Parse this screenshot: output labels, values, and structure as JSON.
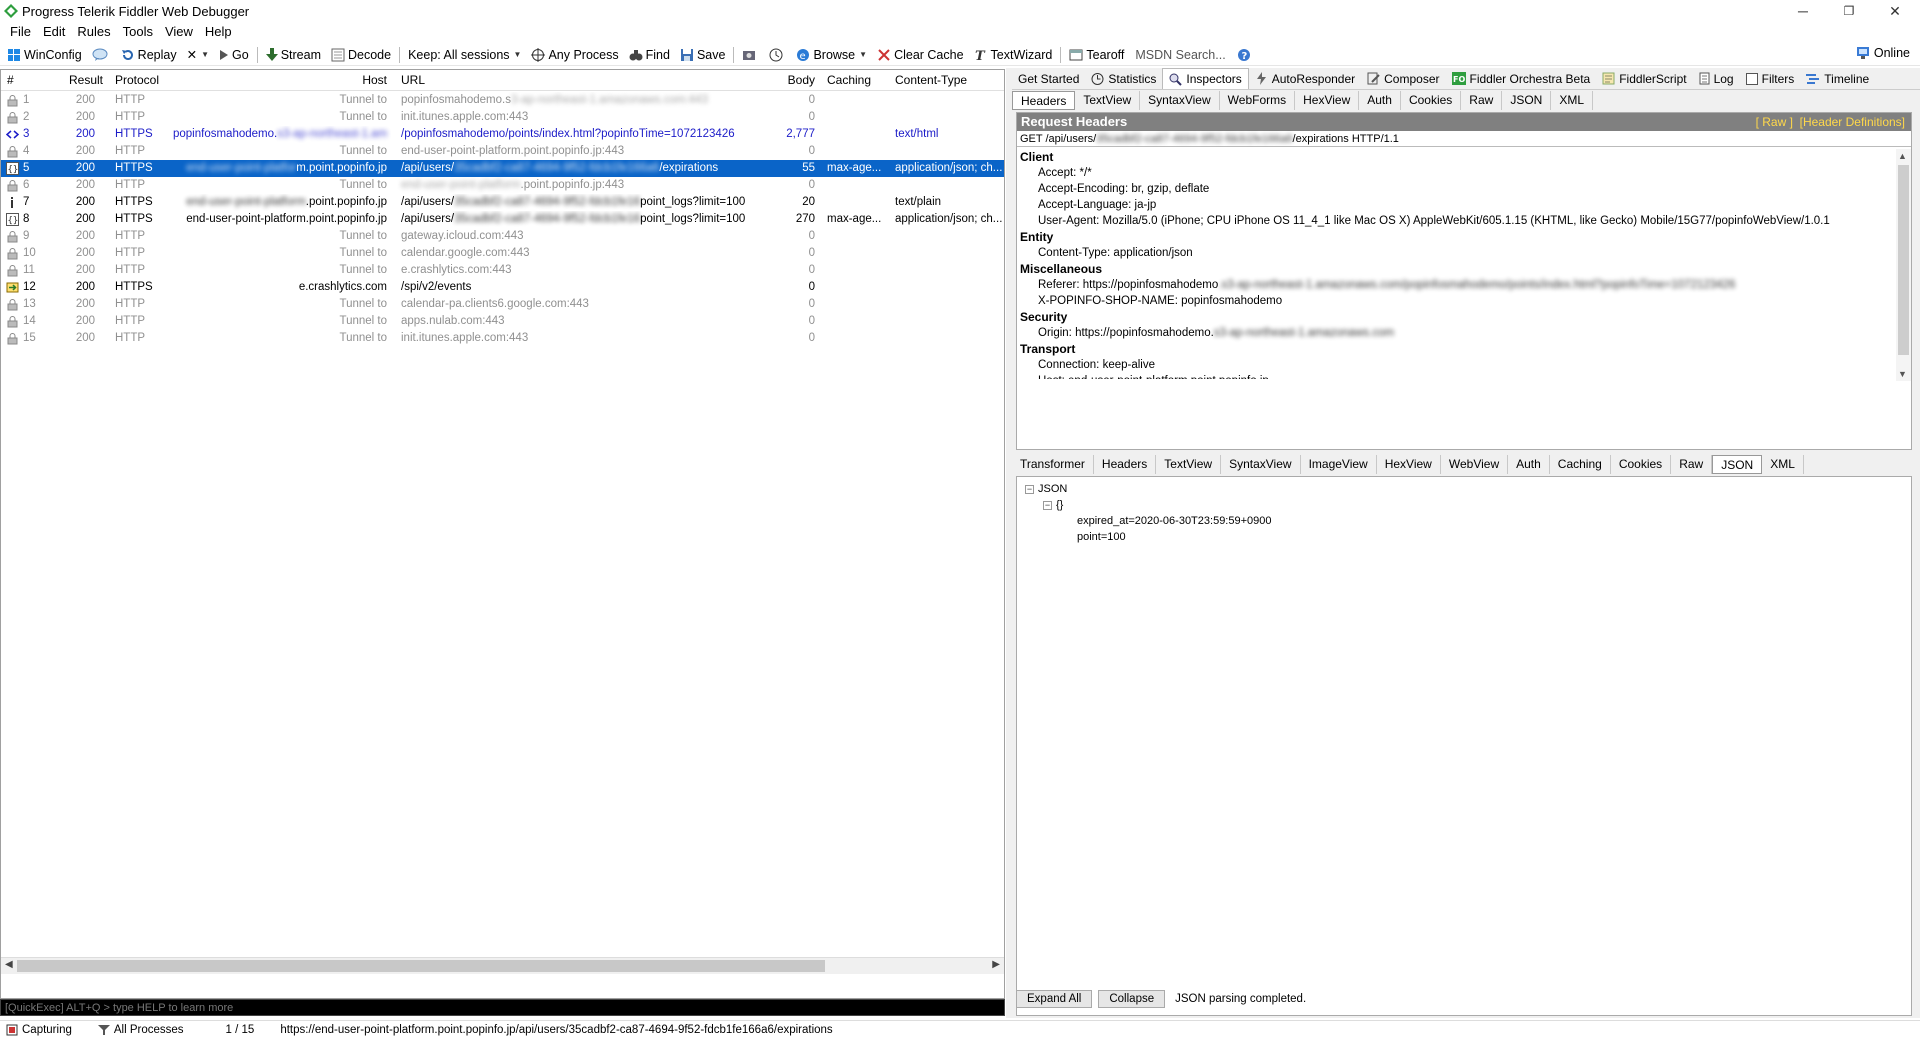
{
  "window": {
    "title": "Progress Telerik Fiddler Web Debugger",
    "min": "─",
    "max": "❐",
    "close": "✕"
  },
  "menu": [
    "File",
    "Edit",
    "Rules",
    "Tools",
    "View",
    "Help"
  ],
  "toolbar": {
    "winconfig": "WinConfig",
    "replay": "Replay",
    "remove": "✕",
    "go": "Go",
    "stream": "Stream",
    "decode": "Decode",
    "keep": "Keep: All sessions",
    "any_process": "Any Process",
    "find": "Find",
    "save": "Save",
    "browse": "Browse",
    "clear_cache": "Clear Cache",
    "textwizard": "TextWizard",
    "tearoff": "Tearoff",
    "msdn_search": "MSDN Search...",
    "online": "Online"
  },
  "sessions": {
    "headers": {
      "num": "#",
      "result": "Result",
      "protocol": "Protocol",
      "host": "Host",
      "url": "URL",
      "body": "Body",
      "caching": "Caching",
      "content_type": "Content-Type"
    },
    "rows": [
      {
        "num": "1",
        "result": "200",
        "protocol": "HTTP",
        "host": "Tunnel to",
        "url": "popinfosmahodemo.s",
        "url_blur": "3-ap-northeast-1.amazonaws.com:443",
        "body": "0",
        "caching": "",
        "ctype": "",
        "type": "tunnel"
      },
      {
        "num": "2",
        "result": "200",
        "protocol": "HTTP",
        "host": "Tunnel to",
        "url": "init.itunes.apple.com:443",
        "url_blur": "",
        "body": "0",
        "caching": "",
        "ctype": "",
        "type": "tunnel"
      },
      {
        "num": "3",
        "result": "200",
        "protocol": "HTTPS",
        "host": "popinfosmahodemo.",
        "host_blur": "s3-ap-northeast-1.am",
        "url": "/popinfosmahodemo/points/index.html?popinfoTime=1072123426",
        "url_blur": "",
        "body": "2,777",
        "caching": "",
        "ctype": "text/html",
        "type": "html"
      },
      {
        "num": "4",
        "result": "200",
        "protocol": "HTTP",
        "host": "Tunnel to",
        "url": "end-user-point-platform.point.popinfo.jp:443",
        "url_blur": "",
        "body": "0",
        "caching": "",
        "ctype": "",
        "type": "tunnel"
      },
      {
        "num": "5",
        "result": "200",
        "protocol": "HTTPS",
        "host_blur": "end-user-point-platfor",
        "host": "m.point.popinfo.jp",
        "url": "/api/users/",
        "url_blur": "35cadbf2-ca87-4694-9f52-fdcb1fe166a6",
        "url_tail": "/expirations",
        "body": "55",
        "caching": "max-age...",
        "ctype": "application/json; ch...",
        "type": "sel"
      },
      {
        "num": "6",
        "result": "200",
        "protocol": "HTTP",
        "host": "Tunnel to",
        "url": "",
        "url_blur": "end-user-point-platform",
        "url_tail": ".point.popinfo.jp:443",
        "body": "0",
        "caching": "",
        "ctype": "",
        "type": "tunnel"
      },
      {
        "num": "7",
        "result": "200",
        "protocol": "HTTPS",
        "host_blur": "end-user-point-platform",
        "host": ".point.popinfo.jp",
        "url": "/api/users/",
        "url_blur": "35cadbf2-ca87-4694-9f52-fdcb1fe16",
        "url_tail": "point_logs?limit=100",
        "body": "20",
        "caching": "",
        "ctype": "text/plain",
        "type": "normal"
      },
      {
        "num": "8",
        "result": "200",
        "protocol": "HTTPS",
        "host": "end-user-point-platform.point.popinfo.jp",
        "url": "/api/users/",
        "url_blur": "35cadbf2-ca87-4694-9f52-fdcb1fe16",
        "url_tail": "point_logs?limit=100",
        "body": "270",
        "caching": "max-age...",
        "ctype": "application/json; ch...",
        "type": "normal"
      },
      {
        "num": "9",
        "result": "200",
        "protocol": "HTTP",
        "host": "Tunnel to",
        "url": "gateway.icloud.com:443",
        "url_blur": "",
        "body": "0",
        "caching": "",
        "ctype": "",
        "type": "tunnel"
      },
      {
        "num": "10",
        "result": "200",
        "protocol": "HTTP",
        "host": "Tunnel to",
        "url": "calendar.google.com:443",
        "url_blur": "",
        "body": "0",
        "caching": "",
        "ctype": "",
        "type": "tunnel"
      },
      {
        "num": "11",
        "result": "200",
        "protocol": "HTTP",
        "host": "Tunnel to",
        "url": "e.crashlytics.com:443",
        "url_blur": "",
        "body": "0",
        "caching": "",
        "ctype": "",
        "type": "tunnel"
      },
      {
        "num": "12",
        "result": "200",
        "protocol": "HTTPS",
        "host": "e.crashlytics.com",
        "url": "/spi/v2/events",
        "url_blur": "",
        "body": "0",
        "caching": "",
        "ctype": "",
        "type": "normal"
      },
      {
        "num": "13",
        "result": "200",
        "protocol": "HTTP",
        "host": "Tunnel to",
        "url": "calendar-pa.clients6.google.com:443",
        "url_blur": "",
        "body": "0",
        "caching": "",
        "ctype": "",
        "type": "tunnel"
      },
      {
        "num": "14",
        "result": "200",
        "protocol": "HTTP",
        "host": "Tunnel to",
        "url": "apps.nulab.com:443",
        "url_blur": "",
        "body": "0",
        "caching": "",
        "ctype": "",
        "type": "tunnel"
      },
      {
        "num": "15",
        "result": "200",
        "protocol": "HTTP",
        "host": "Tunnel to",
        "url": "init.itunes.apple.com:443",
        "url_blur": "",
        "body": "0",
        "caching": "",
        "ctype": "",
        "type": "tunnel"
      }
    ]
  },
  "quickexec": {
    "placeholder": "[QuickExec] ALT+Q > type HELP to learn more"
  },
  "statusbar": {
    "capturing": "Capturing",
    "processes": "All Processes",
    "count": "1 / 15",
    "url": "https://end-user-point-platform.point.popinfo.jp/api/users/35cadbf2-ca87-4694-9f52-fdcb1fe166a6/expirations"
  },
  "panel_tabs": [
    "Get Started",
    "Statistics",
    "Inspectors",
    "AutoResponder",
    "Composer",
    "Fiddler Orchestra Beta",
    "FiddlerScript",
    "Log",
    "Filters",
    "Timeline"
  ],
  "request_tabs": [
    "Headers",
    "TextView",
    "SyntaxView",
    "WebForms",
    "HexView",
    "Auth",
    "Cookies",
    "Raw",
    "JSON",
    "XML"
  ],
  "request": {
    "title": "Request Headers",
    "raw_link": "[ Raw ]",
    "defs_link": "[Header Definitions]",
    "line_start": "GET /api/users/",
    "line_blur": "35cadbf2-ca87-4694-9f52-fdcb1fe166a6",
    "line_end": "/expirations HTTP/1.1",
    "groups": [
      {
        "name": "Client",
        "items": [
          "Accept: */*",
          "Accept-Encoding: br, gzip, deflate",
          "Accept-Language: ja-jp",
          "User-Agent: Mozilla/5.0 (iPhone; CPU iPhone OS 11_4_1 like Mac OS X) AppleWebKit/605.1.15 (KHTML, like Gecko) Mobile/15G77/popinfoWebView/1.0.1"
        ]
      },
      {
        "name": "Entity",
        "items": [
          "Content-Type: application/json"
        ]
      },
      {
        "name": "Miscellaneous",
        "items": [
          "Referer: https://popinfosmahodemo",
          "X-POPINFO-SHOP-NAME: popinfosmahodemo"
        ]
      },
      {
        "name": "Security",
        "items": [
          "Origin: https://popinfosmahodemo."
        ]
      },
      {
        "name": "Transport",
        "items": [
          "Connection: keep-alive",
          "Host: end-user-point-platform.point.popinfo.jp"
        ]
      }
    ],
    "referer_blur": ".s3-ap-northeast-1.amazonaws.com/popinfosmahodemo/points/index.html?popinfoTime=1072123426",
    "origin_blur": "s3-ap-northeast-1.amazonaws.com"
  },
  "response_tabs": [
    "Transformer",
    "Headers",
    "TextView",
    "SyntaxView",
    "ImageView",
    "HexView",
    "WebView",
    "Auth",
    "Caching",
    "Cookies",
    "Raw",
    "JSON",
    "XML"
  ],
  "json_view": {
    "root": "JSON",
    "obj": "{}",
    "fields": [
      "expired_at=2020-06-30T23:59:59+0900",
      "point=100"
    ],
    "expand_all": "Expand All",
    "collapse": "Collapse",
    "status": "JSON parsing completed."
  }
}
